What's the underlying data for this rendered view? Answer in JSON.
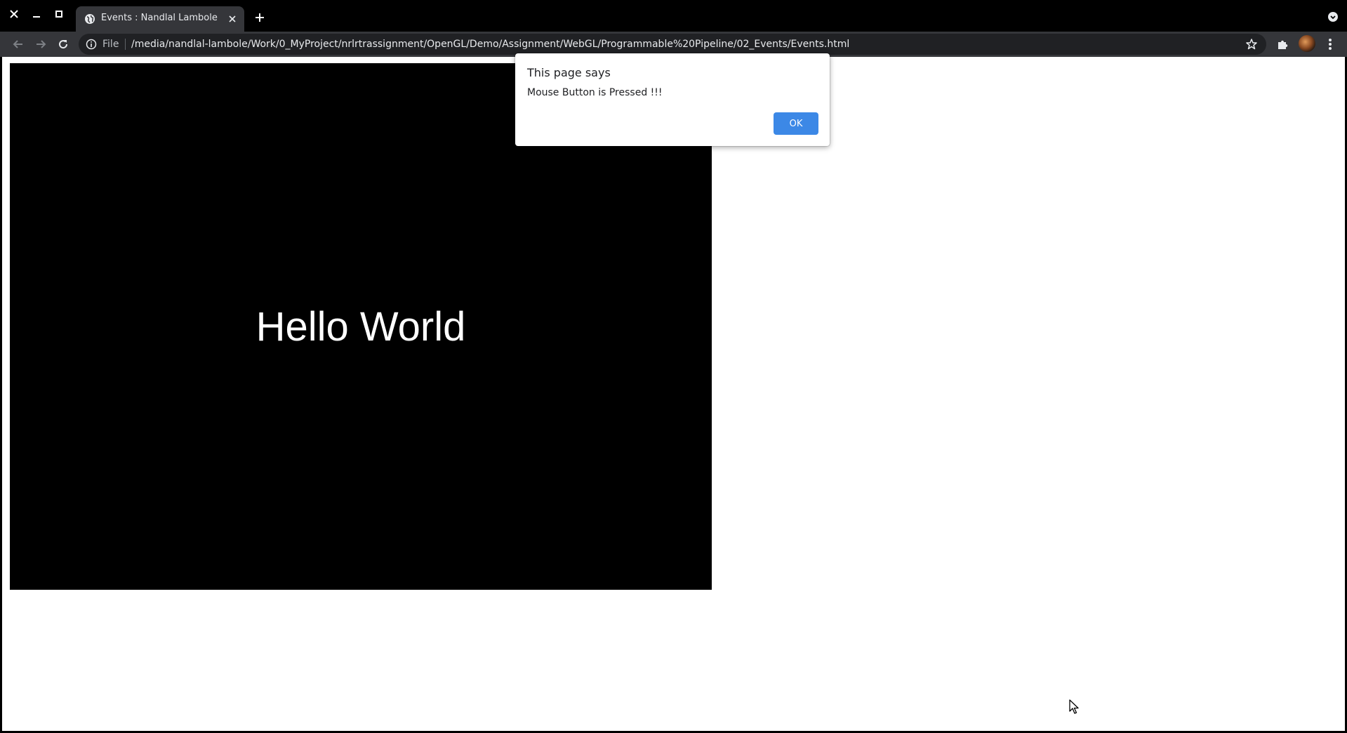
{
  "browser": {
    "window_controls": {
      "close": "close-icon",
      "minimize": "minimize-icon",
      "maximize": "maximize-icon"
    },
    "tab": {
      "title": "Events : Nandlal Lambole",
      "favicon": "globe-icon"
    },
    "toolbar": {
      "scheme_label": "File",
      "url": "/media/nandlal-lambole/Work/0_MyProject/nrlrtrassignment/OpenGL/Demo/Assignment/WebGL/Programmable%20Pipeline/02_Events/Events.html"
    }
  },
  "page": {
    "canvas_text": "Hello World"
  },
  "alert": {
    "title": "This page says",
    "message": "Mouse Button is Pressed !!!",
    "ok_label": "OK"
  },
  "colors": {
    "tabstrip": "#000000",
    "toolbar": "#35363a",
    "omnibox": "#202124",
    "accent": "#3c88e6",
    "canvas_bg": "#000000"
  }
}
